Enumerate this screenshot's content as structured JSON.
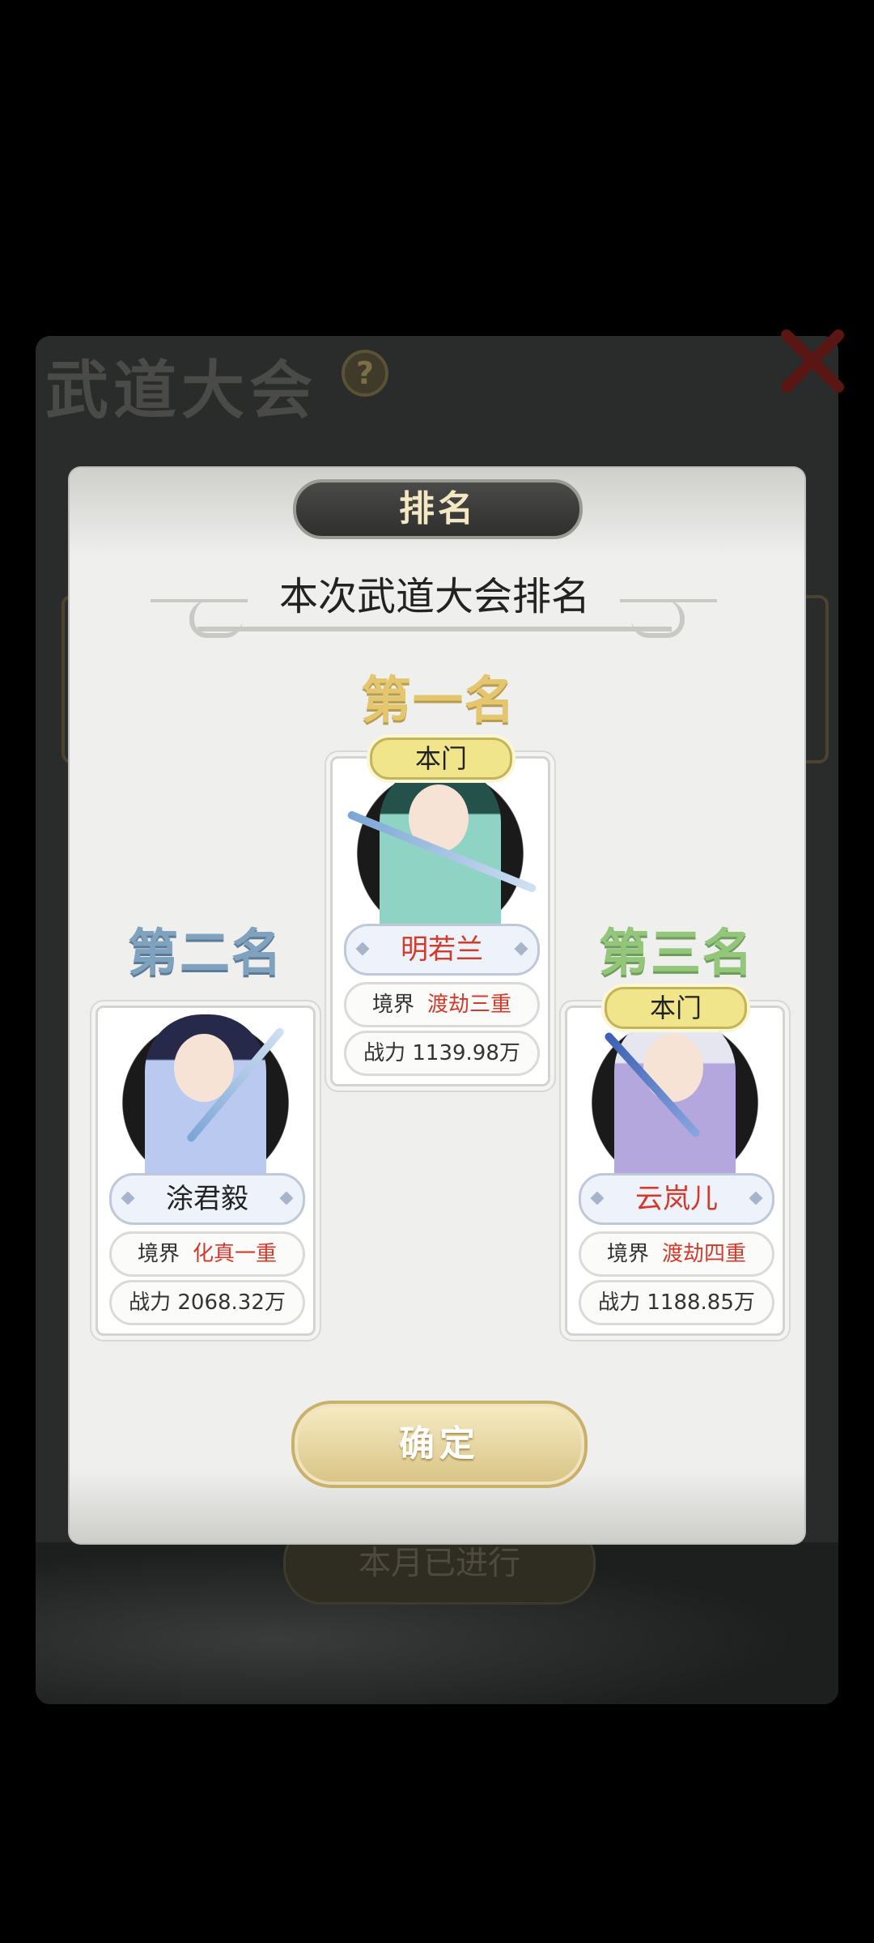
{
  "background": {
    "title": "武道大会",
    "help_glyph": "?",
    "bottom_pill": "本月已进行"
  },
  "modal": {
    "header": "排名",
    "subtitle": "本次武道大会排名",
    "confirm_label": "确定"
  },
  "rankings": [
    {
      "place_label": "第一名",
      "sect_badge": "本门",
      "name": "明若兰",
      "name_color": "#d23a2b",
      "realm_label": "境界",
      "realm": "渡劫三重",
      "power_label": "战力",
      "power": "1139.98万"
    },
    {
      "place_label": "第二名",
      "sect_badge": "",
      "name": "涂君毅",
      "name_color": "#222222",
      "realm_label": "境界",
      "realm": "化真一重",
      "power_label": "战力",
      "power": "2068.32万"
    },
    {
      "place_label": "第三名",
      "sect_badge": "本门",
      "name": "云岚儿",
      "name_color": "#d23a2b",
      "realm_label": "境界",
      "realm": "渡劫四重",
      "power_label": "战力",
      "power": "1188.85万"
    }
  ],
  "colors": {
    "first_place": "#e3c66e",
    "second_place": "#7fa2bf",
    "third_place": "#93c67a",
    "realm_text": "#d23a2b",
    "sect_badge": "#f1e58c"
  }
}
